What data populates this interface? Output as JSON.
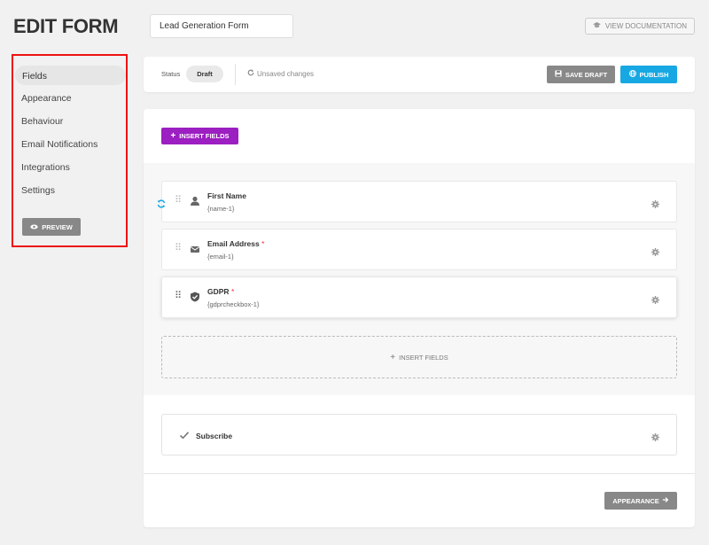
{
  "page": {
    "title": "EDIT FORM"
  },
  "form": {
    "name": "Lead Generation Form"
  },
  "header": {
    "documentation_label": "VIEW DOCUMENTATION"
  },
  "sidebar": {
    "items": [
      {
        "label": "Fields",
        "active": true
      },
      {
        "label": "Appearance"
      },
      {
        "label": "Behaviour"
      },
      {
        "label": "Email Notifications"
      },
      {
        "label": "Integrations"
      },
      {
        "label": "Settings"
      }
    ],
    "preview_label": "PREVIEW",
    "highlight_color": "#e11111"
  },
  "status": {
    "label": "Status",
    "value": "Draft",
    "unsaved_text": "Unsaved changes",
    "save_label": "SAVE DRAFT",
    "publish_label": "PUBLISH"
  },
  "builder": {
    "insert_fields_label": "INSERT FIELDS",
    "fields": [
      {
        "name": "First Name",
        "slug": "{name-1}",
        "required": false,
        "icon": "user-icon"
      },
      {
        "name": "Email Address",
        "slug": "{email-1}",
        "required": true,
        "icon": "envelope-icon"
      },
      {
        "name": "GDPR",
        "slug": "{gdprcheckbox-1}",
        "required": true,
        "icon": "shield-check-icon"
      }
    ],
    "required_marker": "*",
    "dashed_insert_label": "INSERT FIELDS",
    "submit_label": "Subscribe",
    "next_label": "APPEARANCE"
  },
  "colors": {
    "accent_purple": "#9b1fc1",
    "publish_blue": "#17a8e3",
    "neutral_button": "#888888"
  }
}
